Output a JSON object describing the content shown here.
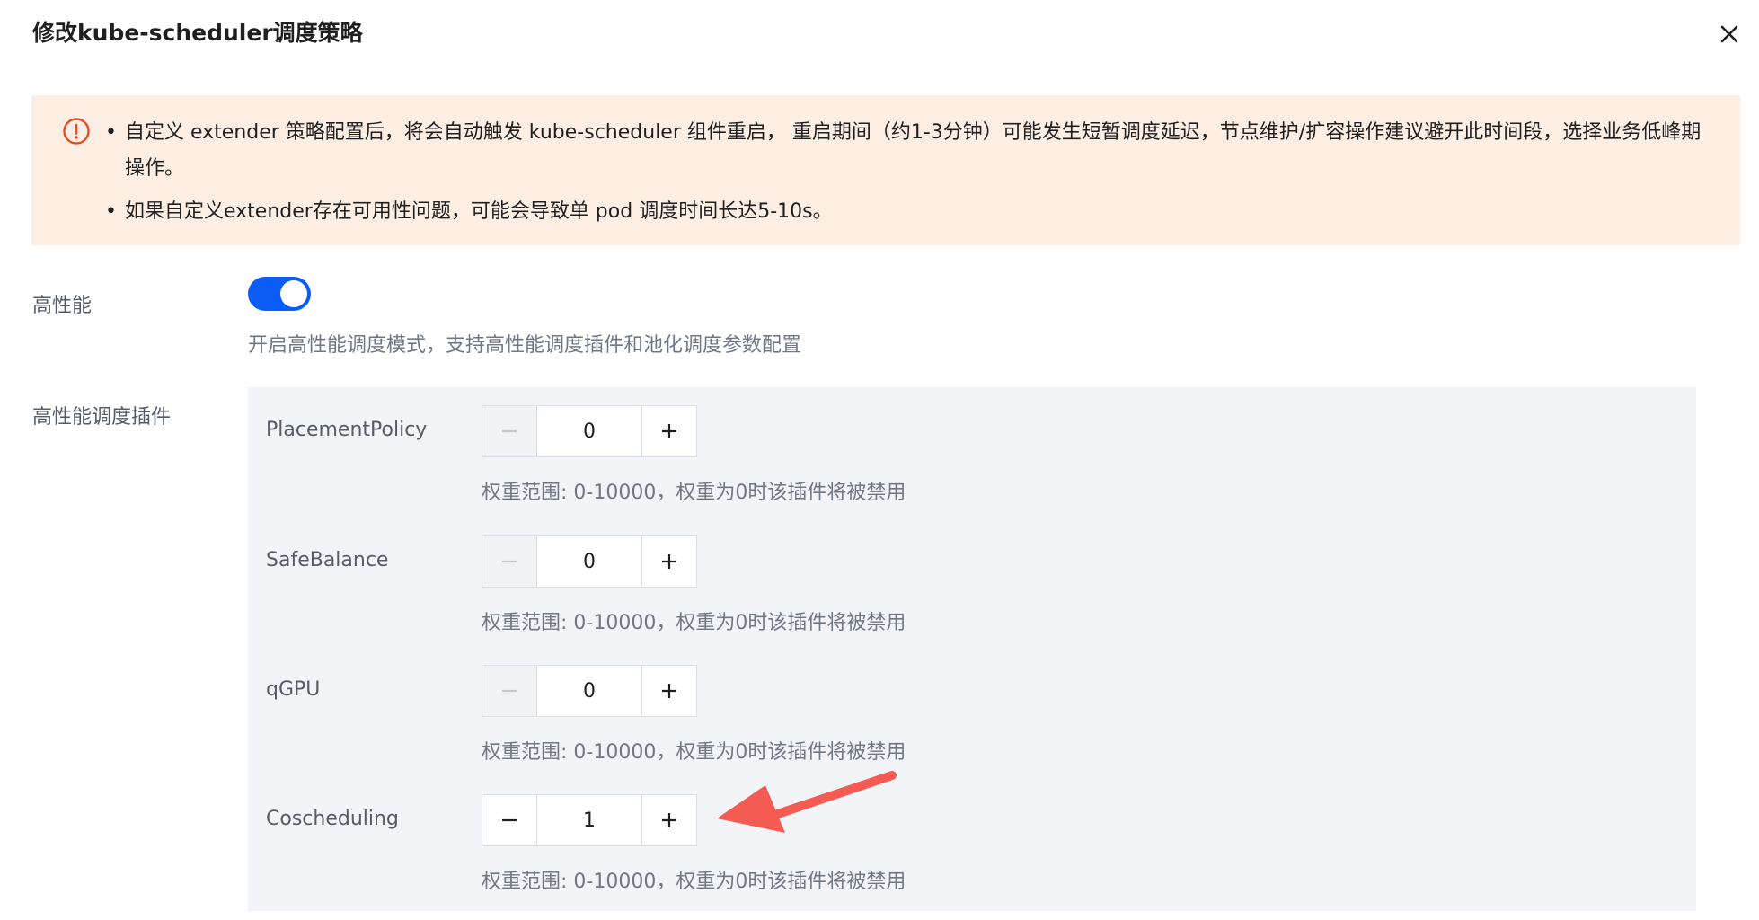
{
  "dialog": {
    "title": "修改kube-scheduler调度策略"
  },
  "alert": {
    "items": [
      "自定义 extender 策略配置后，将会自动触发 kube-scheduler 组件重启， 重启期间（约1-3分钟）可能发生短暂调度延迟，节点维护/扩容操作建议避开此时间段，选择业务低峰期操作。",
      "如果自定义extender存在可用性问题，可能会导致单 pod 调度时间长达5-10s。"
    ]
  },
  "high_performance": {
    "label": "高性能",
    "enabled": true,
    "description": "开启高性能调度模式，支持高性能调度插件和池化调度参数配置"
  },
  "plugins": {
    "label": "高性能调度插件",
    "items": [
      {
        "name": "PlacementPolicy",
        "value": "0",
        "hint": "权重范围: 0-10000，权重为0时该插件将被禁用"
      },
      {
        "name": "SafeBalance",
        "value": "0",
        "hint": "权重范围: 0-10000，权重为0时该插件将被禁用"
      },
      {
        "name": "qGPU",
        "value": "0",
        "hint": "权重范围: 0-10000，权重为0时该插件将被禁用"
      },
      {
        "name": "Coscheduling",
        "value": "1",
        "hint": "权重范围: 0-10000，权重为0时该插件将被禁用"
      }
    ]
  },
  "colors": {
    "primary": "#0a5cf5",
    "alert_bg": "#fdeee4",
    "alert_icon": "#e34d26",
    "panel_bg": "#f3f4f7",
    "annotation_arrow": "#f45b52"
  }
}
